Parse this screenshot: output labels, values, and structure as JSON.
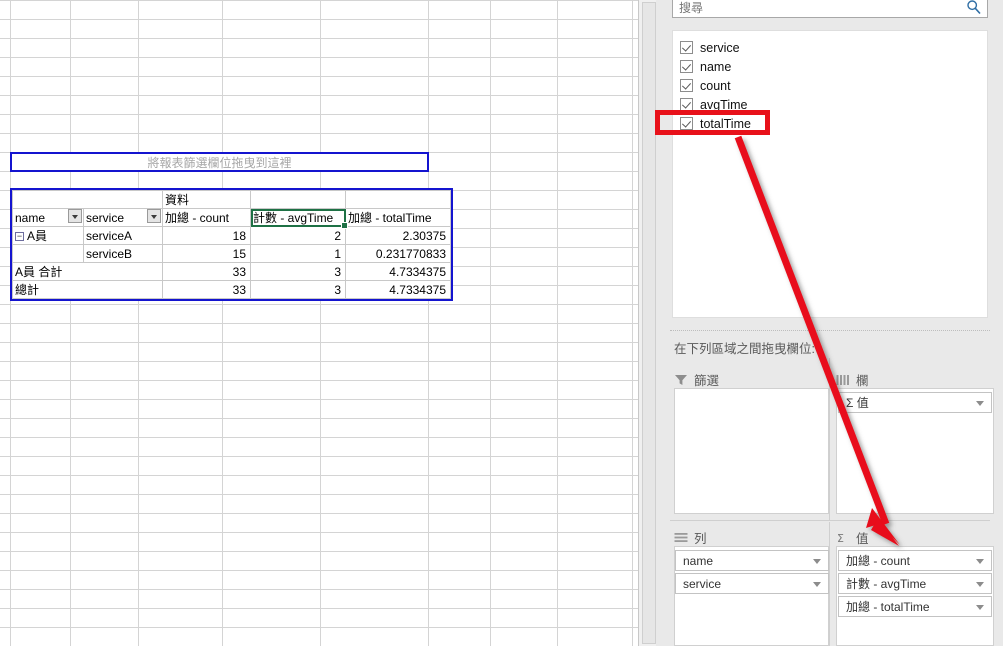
{
  "app": {
    "type": "spreadsheet-pivot-table",
    "locale": "zh-TW"
  },
  "sheet": {
    "filter_dropzone_label": "將報表篩選欄位拖曳到這裡",
    "pivot": {
      "data_corner_label": "資料",
      "row_header_1": "name",
      "row_header_2": "service",
      "value_headers": [
        "加總 - count",
        "計數 - avgTime",
        "加總 - totalTime"
      ],
      "selected_cell": "計數 - avgTime",
      "rows": [
        {
          "name": "A員",
          "expandable": true,
          "service": "serviceA",
          "count": "18",
          "avgTime": "2",
          "totalTime": "2.30375"
        },
        {
          "name": "",
          "expandable": false,
          "service": "serviceB",
          "count": "15",
          "avgTime": "1",
          "totalTime": "0.231770833"
        }
      ],
      "subtotal": {
        "label": "A員 合計",
        "count": "33",
        "avgTime": "3",
        "totalTime": "4.7334375"
      },
      "grandtotal": {
        "label": "總計",
        "count": "33",
        "avgTime": "3",
        "totalTime": "4.7334375"
      }
    }
  },
  "pane": {
    "search": {
      "value": "",
      "placeholder": "搜尋",
      "icon": "search-icon"
    },
    "fields": [
      {
        "label": "service",
        "checked": true
      },
      {
        "label": "name",
        "checked": true
      },
      {
        "label": "count",
        "checked": true
      },
      {
        "label": "avgTime",
        "checked": true
      },
      {
        "label": "totalTime",
        "checked": true
      }
    ],
    "zones_caption": "在下列區域之間拖曳欄位:",
    "zones": {
      "filters": {
        "title": "篩選",
        "icon": "funnel-icon",
        "items": []
      },
      "columns": {
        "title": "欄",
        "icon": "columns-icon",
        "items": [
          {
            "label": "Σ 值"
          }
        ]
      },
      "rows": {
        "title": "列",
        "icon": "rows-icon",
        "items": [
          {
            "label": "name"
          },
          {
            "label": "service"
          }
        ]
      },
      "values": {
        "title": "值",
        "icon": "sigma-icon",
        "items": [
          {
            "label": "加總 - count"
          },
          {
            "label": "計數 - avgTime"
          },
          {
            "label": "加總 - totalTime"
          }
        ]
      }
    }
  },
  "annotation": {
    "highlight_target": "totalTime",
    "arrow_from": "totalTime field checkbox",
    "arrow_to": "值 (Values) drop zone",
    "color": "#e8111a"
  }
}
